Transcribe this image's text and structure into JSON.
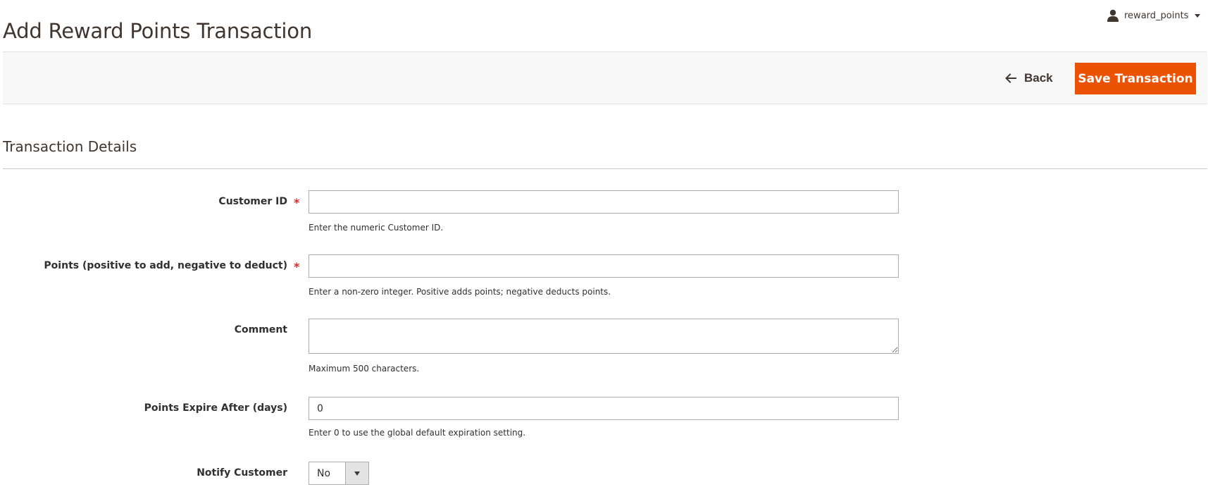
{
  "page": {
    "title": "Add Reward Points Transaction"
  },
  "user_menu": {
    "username": "reward_points",
    "icon": "user-icon"
  },
  "actions": {
    "back_label": "Back",
    "save_label": "Save Transaction",
    "save_color": "#eb5202"
  },
  "section": {
    "title": "Transaction Details"
  },
  "form": {
    "customer_id": {
      "label": "Customer ID",
      "required": true,
      "value": "",
      "note": "Enter the numeric Customer ID."
    },
    "points": {
      "label": "Points (positive to add, negative to deduct)",
      "required": true,
      "value": "",
      "note": "Enter a non-zero integer. Positive adds points; negative deducts points."
    },
    "comment": {
      "label": "Comment",
      "required": false,
      "value": "",
      "note": "Maximum 500 characters."
    },
    "expire_days": {
      "label": "Points Expire After (days)",
      "required": false,
      "value": "0",
      "note": "Enter 0 to use the global default expiration setting."
    },
    "notify_customer": {
      "label": "Notify Customer",
      "required": false,
      "value": "No"
    }
  },
  "required_marker": "*"
}
